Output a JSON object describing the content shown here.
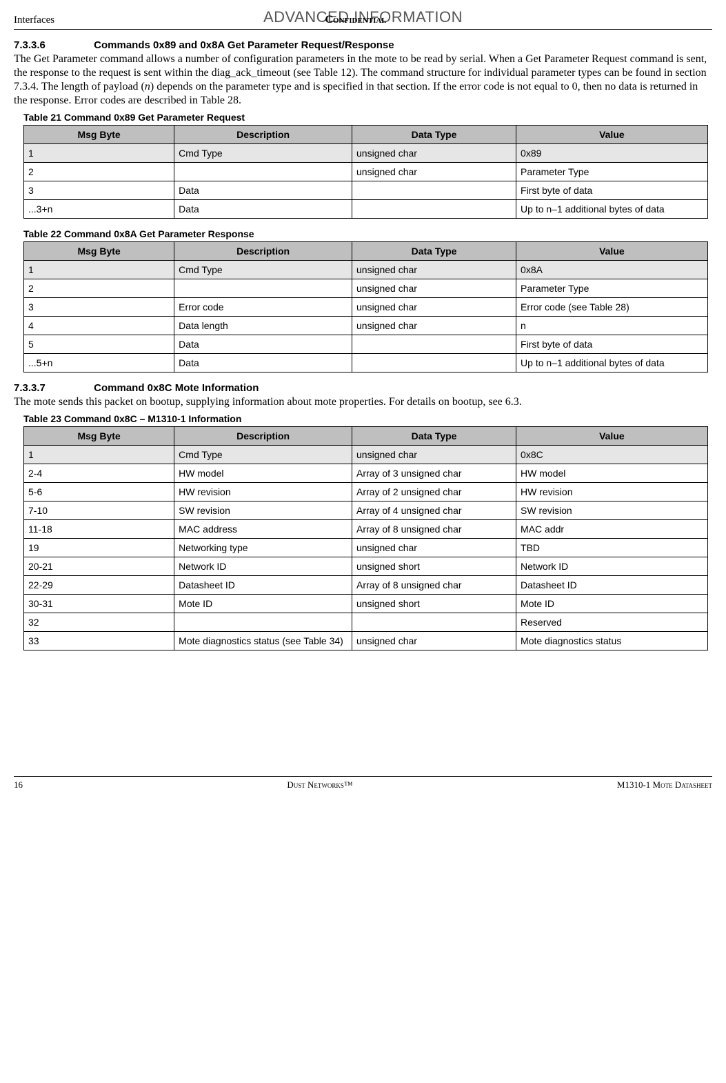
{
  "header": {
    "banner": "ADVANCED INFORMATION",
    "left": "Interfaces",
    "center": "Confidential"
  },
  "section1": {
    "num": "7.3.3.6",
    "title": "Commands 0x89 and 0x8A Get Parameter Request/Response",
    "para_a": "The Get Parameter command allows a number of configuration parameters in the mote to be read by serial. When a Get Parameter Request command is sent, the response to the request is sent within the diag_ack_timeout (see Table 12). The command structure for individual parameter types can be found in section 7.3.4. The length of payload (",
    "para_i": "n",
    "para_b": ") depends on the parameter type and is specified in that section. If the error code is not equal to 0, then no data is returned in the response. Error codes are described in Table 28."
  },
  "table21": {
    "caption": "Table 21    Command 0x89 Get Parameter Request",
    "headers": [
      "Msg Byte",
      "Description",
      "Data Type",
      "Value"
    ],
    "rows": [
      {
        "shaded": true,
        "c": [
          "1",
          "Cmd Type",
          "unsigned char",
          "0x89"
        ]
      },
      {
        "shaded": false,
        "c": [
          "2",
          "",
          "unsigned char",
          "Parameter Type"
        ]
      },
      {
        "shaded": false,
        "c": [
          "3",
          "Data",
          "",
          "First byte of data"
        ]
      },
      {
        "shaded": false,
        "c": [
          " ...3+n",
          "Data",
          "",
          "Up to n–1 additional bytes of data"
        ]
      }
    ]
  },
  "table22": {
    "caption": "Table 22    Command 0x8A Get Parameter Response",
    "headers": [
      "Msg Byte",
      "Description",
      "Data Type",
      "Value"
    ],
    "rows": [
      {
        "shaded": true,
        "c": [
          "1",
          "Cmd Type",
          "unsigned char",
          "0x8A"
        ]
      },
      {
        "shaded": false,
        "c": [
          "2",
          "",
          "unsigned char",
          "Parameter Type"
        ]
      },
      {
        "shaded": false,
        "c": [
          "3",
          "Error code",
          "unsigned char",
          "Error code (see Table 28)"
        ]
      },
      {
        "shaded": false,
        "c": [
          "4",
          "Data length",
          "unsigned char",
          "n"
        ]
      },
      {
        "shaded": false,
        "c": [
          "5",
          "Data",
          "",
          "First byte of data"
        ]
      },
      {
        "shaded": false,
        "c": [
          " ...5+n",
          "Data",
          "",
          "Up to n–1 additional bytes of data"
        ]
      }
    ]
  },
  "section2": {
    "num": "7.3.3.7",
    "title": "Command 0x8C Mote Information",
    "para": "The mote sends this packet on bootup, supplying information about mote properties. For details on bootup, see 6.3."
  },
  "table23": {
    "caption": "Table 23    Command 0x8C – M1310-1 Information",
    "headers": [
      "Msg Byte",
      "Description",
      "Data Type",
      "Value"
    ],
    "rows": [
      {
        "shaded": true,
        "c": [
          "1",
          "Cmd Type",
          "unsigned char",
          "0x8C"
        ]
      },
      {
        "shaded": false,
        "c": [
          "2-4",
          "HW model",
          "Array of 3 unsigned char",
          "HW model"
        ]
      },
      {
        "shaded": false,
        "c": [
          "5-6",
          "HW revision",
          "Array of 2 unsigned char",
          "HW revision"
        ]
      },
      {
        "shaded": false,
        "c": [
          "7-10",
          "SW revision",
          "Array of 4 unsigned char",
          "SW revision"
        ]
      },
      {
        "shaded": false,
        "c": [
          "11-18",
          "MAC address",
          "Array of 8 unsigned char",
          "MAC addr"
        ]
      },
      {
        "shaded": false,
        "c": [
          "19",
          "Networking type",
          "unsigned char",
          "TBD"
        ]
      },
      {
        "shaded": false,
        "c": [
          "20-21",
          "Network ID",
          "unsigned short",
          "Network ID"
        ]
      },
      {
        "shaded": false,
        "c": [
          "22-29",
          "Datasheet ID",
          "Array of 8 unsigned char",
          "Datasheet ID"
        ]
      },
      {
        "shaded": false,
        "c": [
          "30-31",
          "Mote ID",
          "unsigned short",
          "Mote ID"
        ]
      },
      {
        "shaded": false,
        "c": [
          "32",
          "",
          "",
          "Reserved"
        ]
      },
      {
        "shaded": false,
        "c": [
          "33",
          "Mote diagnostics status (see Table 34)",
          "unsigned char",
          "Mote diagnostics status"
        ]
      }
    ]
  },
  "footer": {
    "left": "16",
    "center": "Dust Networks™",
    "right": "M1310-1 Mote Datasheet"
  }
}
